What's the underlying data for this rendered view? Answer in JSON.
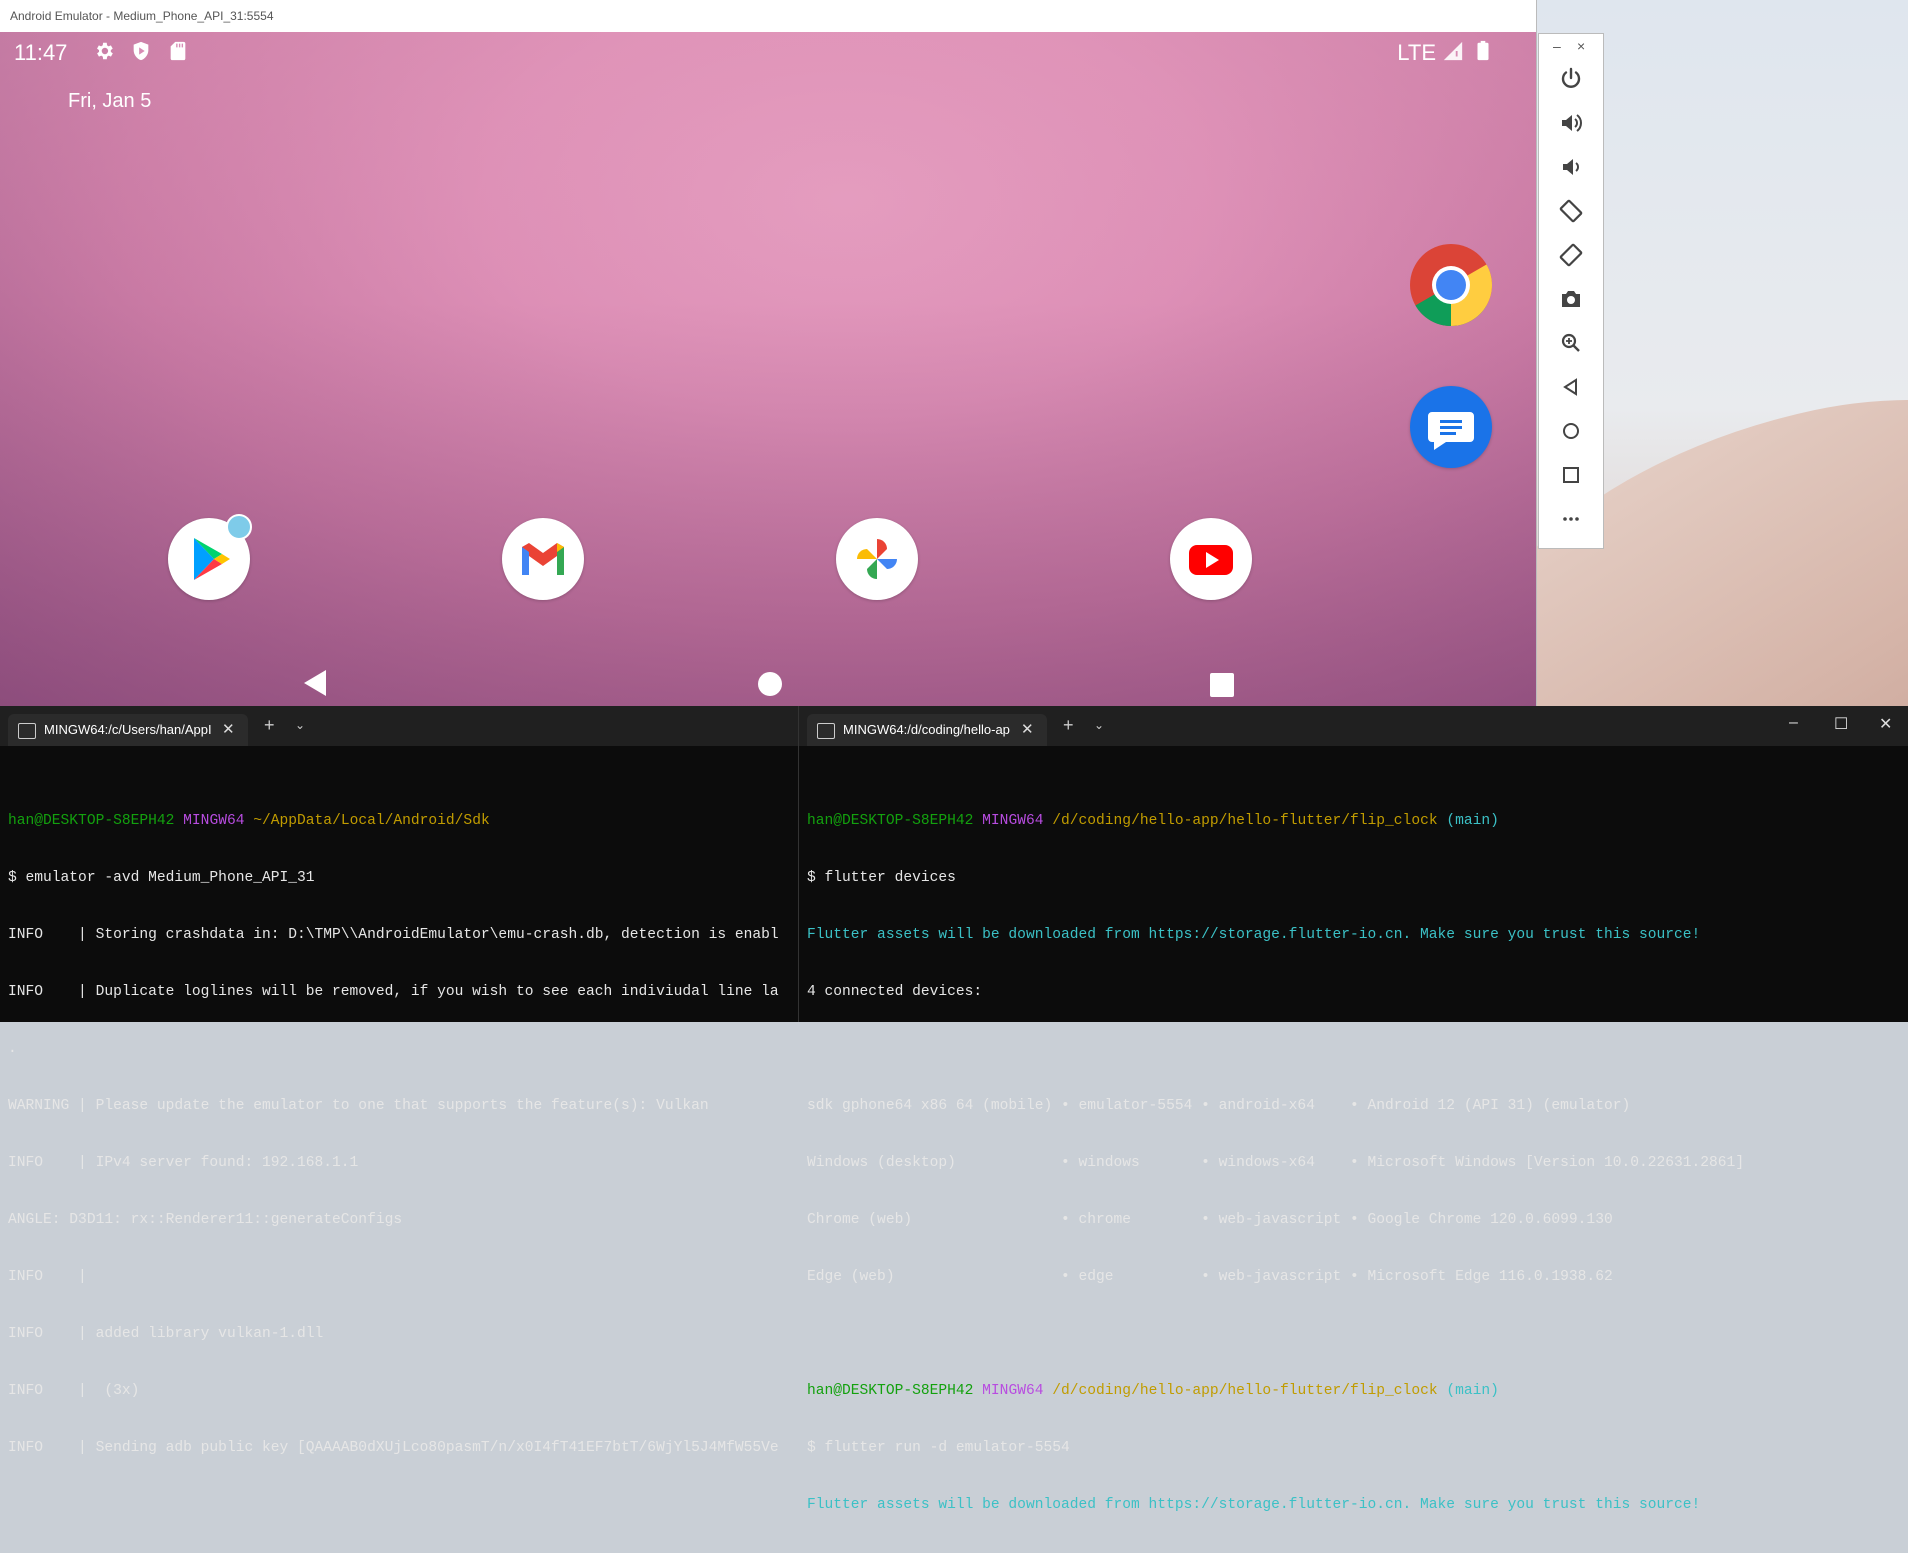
{
  "emulator": {
    "window_title": "Android Emulator - Medium_Phone_API_31:5554",
    "status_bar": {
      "time": "11:47",
      "network": "LTE"
    },
    "date": "Fri, Jan 5",
    "home_apps": [
      "play-store",
      "gmail",
      "photos",
      "youtube"
    ],
    "side_apps": [
      "chrome",
      "messages"
    ],
    "nav": [
      "back",
      "home",
      "recents"
    ]
  },
  "controls": {
    "minimize": "–",
    "close": "×",
    "buttons": [
      "power-icon",
      "volume-up-icon",
      "volume-down-icon",
      "rotate-left-icon",
      "rotate-right-icon",
      "camera-icon",
      "zoom-icon",
      "back-icon",
      "home-icon",
      "overview-icon",
      "more-icon"
    ]
  },
  "terminal1": {
    "tab_label": "MINGW64:/c/Users/han/AppI",
    "prompt": {
      "user": "han@DESKTOP-S8EPH42",
      "shell": "MINGW64",
      "path": "~/AppData/Local/Android/Sdk"
    },
    "lines": [
      "$ emulator -avd Medium_Phone_API_31",
      "INFO    | Storing crashdata in: D:\\TMP\\\\AndroidEmulator\\emu-crash.db, detection is enabl",
      "INFO    | Duplicate loglines will be removed, if you wish to see each indiviudal line la",
      ".",
      "WARNING | Please update the emulator to one that supports the feature(s): Vulkan",
      "INFO    | IPv4 server found: 192.168.1.1",
      "ANGLE: D3D11: rx::Renderer11::generateConfigs",
      "INFO    |",
      "INFO    | added library vulkan-1.dll",
      "INFO    |  (3x)",
      "INFO    | Sending adb public key [QAAAAB0dXUjLco80pasmT/n/x0I4fT41EF7btT/6WjYl5J4MfW55Ve"
    ]
  },
  "terminal2": {
    "tab_label": "MINGW64:/d/coding/hello-ap",
    "prompt": {
      "user": "han@DESKTOP-S8EPH42",
      "shell": "MINGW64",
      "path": "/d/coding/hello-app/hello-flutter/flip_clock",
      "branch": "(main)"
    },
    "cmd1": "$ flutter devices",
    "assets_msg": "Flutter assets will be downloaded from https://storage.flutter-io.cn. Make sure you trust this source!",
    "connected": "4 connected devices:",
    "devices": [
      "sdk gphone64 x86 64 (mobile) • emulator-5554 • android-x64    • Android 12 (API 31) (emulator)",
      "Windows (desktop)            • windows       • windows-x64    • Microsoft Windows [Version 10.0.22631.2861]",
      "Chrome (web)                 • chrome        • web-javascript • Google Chrome 120.0.6099.130",
      "Edge (web)                   • edge          • web-javascript • Microsoft Edge 116.0.1938.62"
    ],
    "cmd2": "$ flutter run -d emulator-5554",
    "assets_msg2": "Flutter assets will be downloaded from https://storage.flutter-io.cn. Make sure you trust this source!"
  },
  "terminal_window": {
    "minimize": "–",
    "maximize": "☐",
    "close": "✕"
  },
  "colors": {
    "screen_pink": "#dd8fb6",
    "terminal_bg": "#0c0c0c",
    "prompt_green": "#13a10e",
    "prompt_magenta": "#b84ce0",
    "path_yellow": "#c19c00",
    "info_cyan": "#3bc1c6"
  }
}
